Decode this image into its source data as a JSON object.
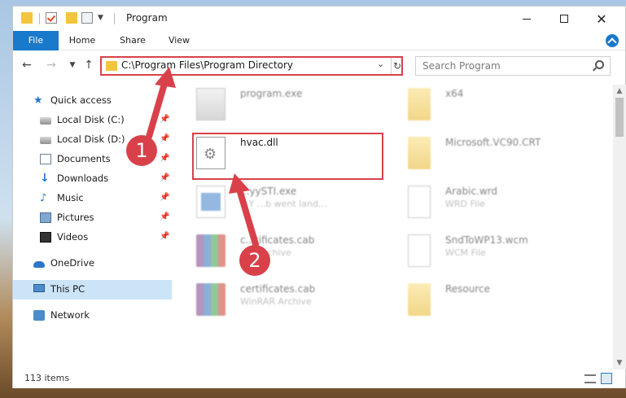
{
  "window": {
    "title": "Program",
    "controls": {
      "minimize": "minimize",
      "maximize": "maximize",
      "close": "✕"
    }
  },
  "ribbon": {
    "tabs": [
      {
        "label": "File"
      },
      {
        "label": "Home"
      },
      {
        "label": "Share"
      },
      {
        "label": "View"
      }
    ]
  },
  "nav": {
    "address": "C:\\Program Files\\Program Directory",
    "search_placeholder": "Search Program"
  },
  "sidebar": {
    "items": [
      {
        "label": "Quick access",
        "icon": "star-icon",
        "pinned": false
      },
      {
        "label": "Local Disk (C:)",
        "icon": "disk-icon",
        "pinned": true
      },
      {
        "label": "Local Disk (D:)",
        "icon": "disk-icon",
        "pinned": true
      },
      {
        "label": "Documents",
        "icon": "documents-icon",
        "pinned": true
      },
      {
        "label": "Downloads",
        "icon": "downloads-icon",
        "pinned": true
      },
      {
        "label": "Music",
        "icon": "music-icon",
        "pinned": true
      },
      {
        "label": "Pictures",
        "icon": "pictures-icon",
        "pinned": true
      },
      {
        "label": "Videos",
        "icon": "videos-icon",
        "pinned": true
      },
      {
        "label": "OneDrive",
        "icon": "onedrive-icon",
        "pinned": false
      },
      {
        "label": "This PC",
        "icon": "this-pc-icon",
        "pinned": false,
        "selected": true
      },
      {
        "label": "Network",
        "icon": "network-icon",
        "pinned": false
      }
    ]
  },
  "files": {
    "left": [
      {
        "name": "program.exe",
        "type": "",
        "icon": "exe-icon"
      },
      {
        "name": "hvac.dll",
        "type": "",
        "icon": "dll-icon"
      },
      {
        "name": "...yySTI.exe",
        "type": "...Y ...b went land...",
        "icon": "app-icon"
      },
      {
        "name": "c...tificates.cab",
        "type": "...R Archive",
        "icon": "rar-icon"
      },
      {
        "name": "certificates.cab",
        "type": "WinRAR Archive",
        "icon": "rar-icon"
      }
    ],
    "right": [
      {
        "name": "x64",
        "type": "",
        "icon": "folder-icon"
      },
      {
        "name": "Microsoft.VC90.CRT",
        "type": "",
        "icon": "folder-icon"
      },
      {
        "name": "Arabic.wrd",
        "type": "WRD File",
        "icon": "blank-file-icon"
      },
      {
        "name": "SndToWP13.wcm",
        "type": "WCM File",
        "icon": "blank-file-icon"
      },
      {
        "name": "Resource",
        "type": "",
        "icon": "folder-icon"
      }
    ]
  },
  "status": {
    "item_count": "113 items"
  },
  "annotations": {
    "step1": "1",
    "step2": "2",
    "color": "#d9414a"
  },
  "colors": {
    "accent": "#1979ca",
    "selection": "#cce4f7",
    "highlight": "#d9414a"
  }
}
